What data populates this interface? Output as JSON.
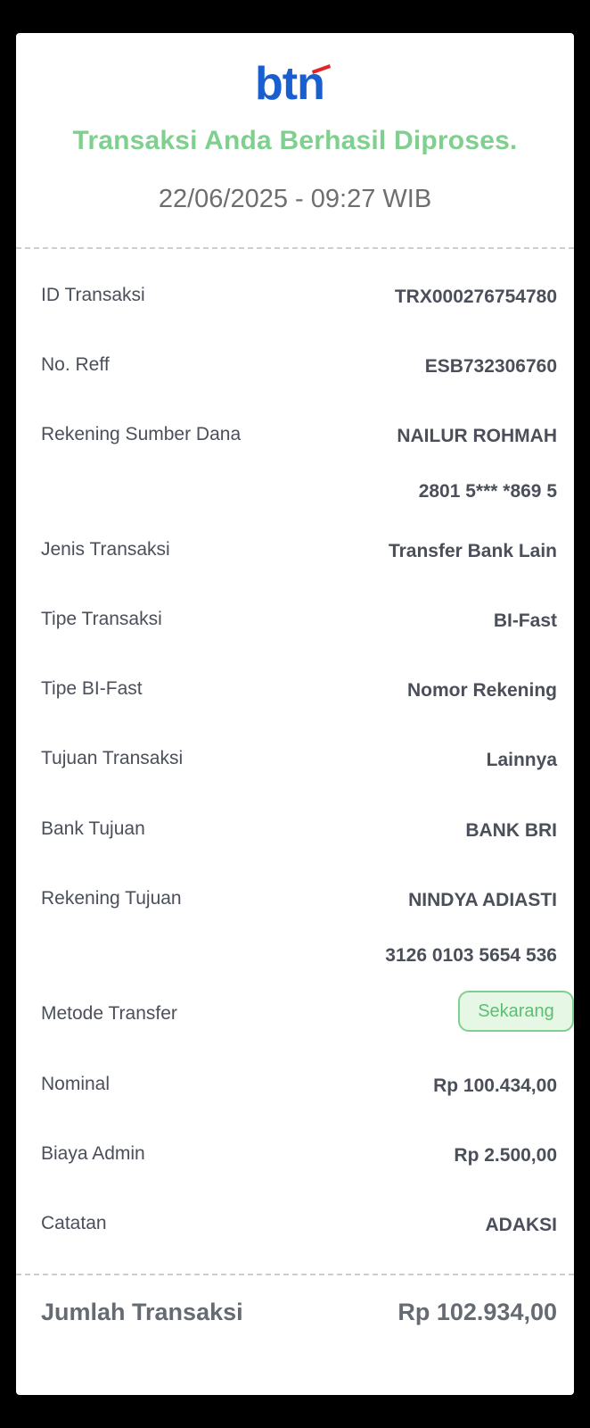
{
  "receipt": {
    "logo_text": "btn",
    "status": "Transaksi Anda Berhasil Diproses.",
    "datetime": "22/06/2025 - 09:27 WIB"
  },
  "details": [
    {
      "label": "ID Transaksi",
      "value": "TRX000276754780"
    },
    {
      "label": "No. Reff",
      "value": "ESB732306760"
    },
    {
      "label": "Rekening Sumber Dana",
      "value": "NAILUR ROHMAH",
      "value2": "2801 5*** *869 5"
    },
    {
      "label": "Jenis Transaksi",
      "value": "Transfer Bank Lain"
    },
    {
      "label": "Tipe Transaksi",
      "value": "BI-Fast"
    },
    {
      "label": "Tipe BI-Fast",
      "value": "Nomor Rekening"
    },
    {
      "label": "Tujuan Transaksi",
      "value": "Lainnya"
    },
    {
      "label": "Bank Tujuan",
      "value": "BANK BRI"
    },
    {
      "label": "Rekening Tujuan",
      "value": "NINDYA ADIASTI",
      "value2": "3126 0103 5654 536"
    },
    {
      "label": "Metode Transfer",
      "value": "Sekarang"
    },
    {
      "label": "Nominal",
      "value": "Rp 100.434,00"
    },
    {
      "label": "Biaya Admin",
      "value": "Rp 2.500,00"
    },
    {
      "label": "Catatan",
      "value": "ADAKSI"
    }
  ],
  "total": {
    "label": "Jumlah Transaksi",
    "value": "Rp 102.934,00"
  },
  "colors": {
    "brand_blue": "#1a5fd0",
    "brand_red": "#e0262b",
    "success_green": "#7fd08e"
  }
}
